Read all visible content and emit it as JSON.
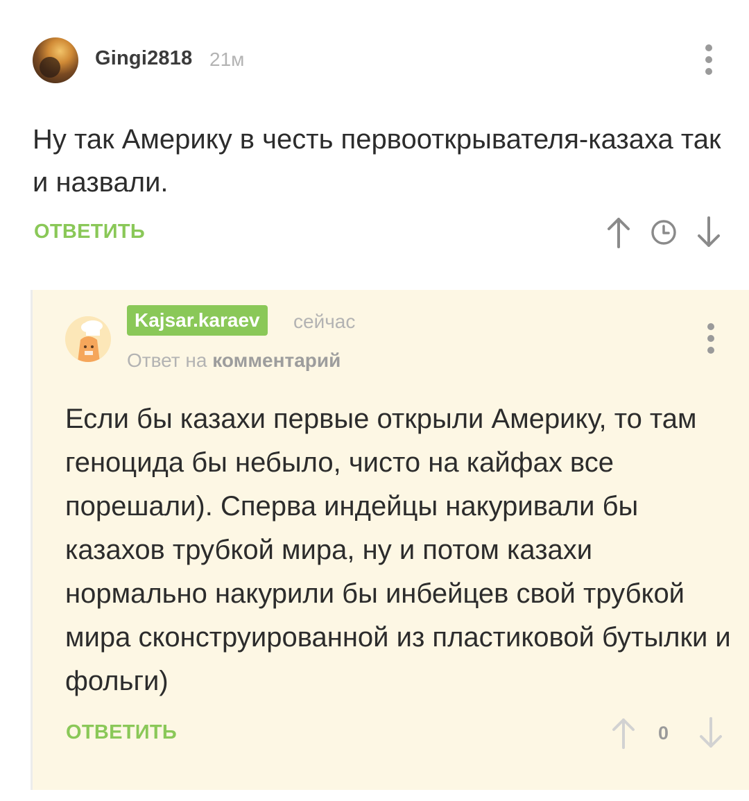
{
  "comment": {
    "username": "Gingi2818",
    "time": "21м",
    "text": "Ну так Америку в честь первооткрывателя-казаха так и назвали.",
    "reply_label": "ОТВЕТИТЬ",
    "icons": {
      "avatar": "avatar-image",
      "menu": "more-vertical-icon",
      "upvote": "arrow-up-icon",
      "clock": "clock-icon",
      "downvote": "arrow-down-icon"
    }
  },
  "reply": {
    "username": "Kajsar.karaev",
    "time": "сейчас",
    "reply_to_prefix": "Ответ на",
    "reply_to_link": "комментарий",
    "text": "Если бы казахи первые открыли Америку, то там геноцида бы небыло, чисто на кайфах все порешали). Сперва индейцы накуривали бы казахов трубкой мира, ну и потом казахи нормально накурили бы инбейцев свой трубкой мира сконструированной из пластиковой бутылки и фольги)",
    "reply_label": "ОТВЕТИТЬ",
    "score": "0",
    "icons": {
      "avatar": "avatar-image",
      "menu": "more-vertical-icon",
      "upvote": "arrow-up-icon",
      "downvote": "arrow-down-icon"
    }
  },
  "colors": {
    "accent_green": "#8ac858",
    "reply_background": "#fdf7e4",
    "text": "#2c2c2c",
    "muted": "#b3b3b3"
  }
}
